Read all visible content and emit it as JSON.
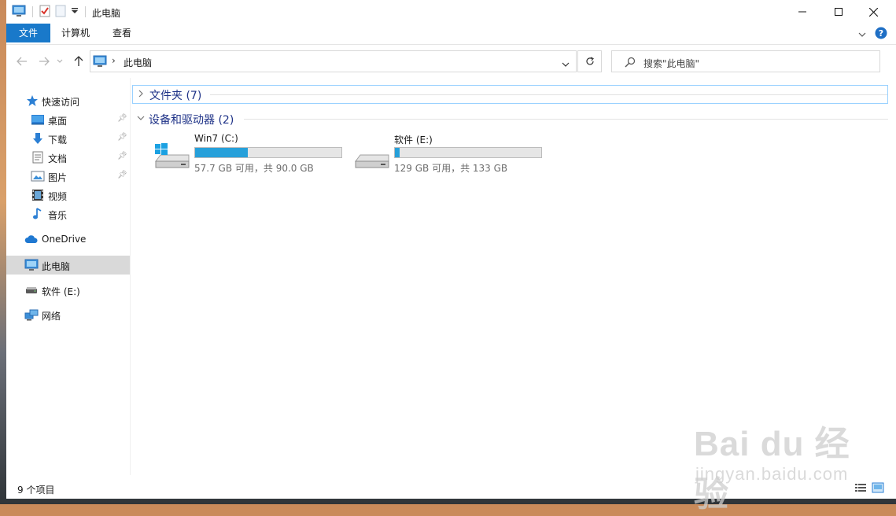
{
  "window": {
    "title": "此电脑",
    "controls": [
      "minimize-icon",
      "maximize-icon",
      "close-icon"
    ]
  },
  "ribbon": {
    "tabs": [
      {
        "label": "文件",
        "active": true
      },
      {
        "label": "计算机"
      },
      {
        "label": "查看"
      }
    ]
  },
  "address": {
    "path": "此电脑",
    "search_placeholder": "搜索\"此电脑\""
  },
  "sidebar": {
    "quick_access": "快速访问",
    "pinned": [
      {
        "label": "桌面",
        "icon": "desktop-icon",
        "pinned": true
      },
      {
        "label": "下载",
        "icon": "download-icon",
        "pinned": true
      },
      {
        "label": "文档",
        "icon": "documents-icon",
        "pinned": true
      },
      {
        "label": "图片",
        "icon": "pictures-icon",
        "pinned": true
      },
      {
        "label": "视频",
        "icon": "videos-icon",
        "pinned": false
      },
      {
        "label": "音乐",
        "icon": "music-icon",
        "pinned": false
      }
    ],
    "onedrive": "OneDrive",
    "this_pc": "此电脑",
    "drive_e": "软件 (E:)",
    "network": "网络"
  },
  "content": {
    "folders_group": "文件夹 (7)",
    "devices_group": "设备和驱动器 (2)",
    "drives": [
      {
        "name": "Win7 (C:)",
        "free_text": "57.7 GB 可用，共 90.0 GB",
        "used_fraction": 0.359,
        "icon": "windows-drive-icon"
      },
      {
        "name": "软件 (E:)",
        "free_text": "129 GB 可用，共 133 GB",
        "used_fraction": 0.03,
        "icon": "hard-drive-icon"
      }
    ]
  },
  "status": {
    "items_count": "9 个项目"
  },
  "watermark": {
    "brand": "Bai du 经验",
    "url": "jingyan.baidu.com"
  },
  "colors": {
    "accent": "#1979ca",
    "drive_bar": "#26a0da",
    "group_title": "#1e3287",
    "selected": "#d9d9d9"
  }
}
